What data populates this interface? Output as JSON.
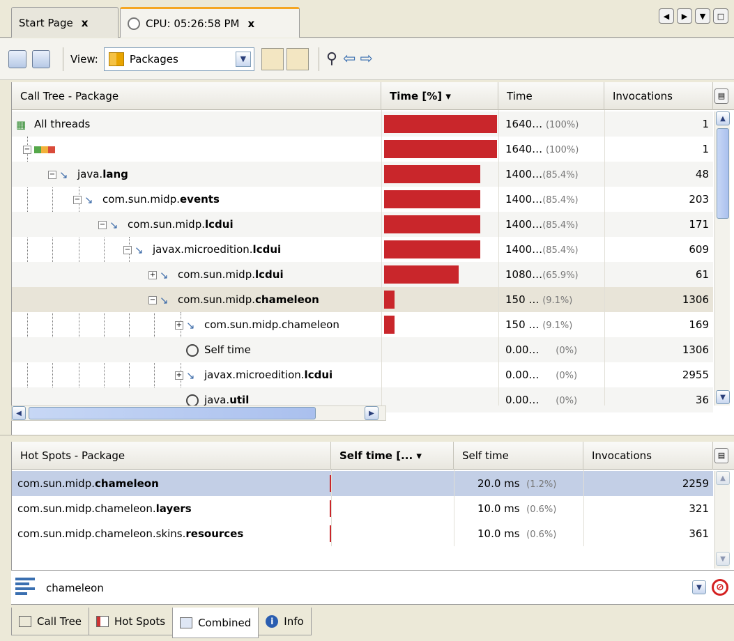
{
  "tabs": [
    {
      "label": "Start Page",
      "close": "x"
    },
    {
      "label": "CPU: 05:26:58 PM",
      "close": "x"
    }
  ],
  "toolbar": {
    "view_label": "View:",
    "view_value": "Packages"
  },
  "call_tree": {
    "headers": {
      "name": "Call Tree - Package",
      "time_pct": "Time [%] ▾",
      "time": "Time",
      "invocations": "Invocations"
    },
    "rows": [
      {
        "prefix": "",
        "bold": "All threads",
        "time": "1640…",
        "pct": "(100%)",
        "bar": 1.0,
        "inv": "1"
      },
      {
        "prefix": "",
        "bold": "",
        "time": "1640…",
        "pct": "(100%)",
        "bar": 1.0,
        "inv": "1"
      },
      {
        "prefix": "java.",
        "bold": "lang",
        "time": "1400…",
        "pct": "(85.4%)",
        "bar": 0.854,
        "inv": "48"
      },
      {
        "prefix": "com.sun.midp.",
        "bold": "events",
        "time": "1400…",
        "pct": "(85.4%)",
        "bar": 0.854,
        "inv": "203"
      },
      {
        "prefix": "com.sun.midp.",
        "bold": "lcdui",
        "time": "1400…",
        "pct": "(85.4%)",
        "bar": 0.854,
        "inv": "171"
      },
      {
        "prefix": "javax.microedition.",
        "bold": "lcdui",
        "time": "1400…",
        "pct": "(85.4%)",
        "bar": 0.854,
        "inv": "609"
      },
      {
        "prefix": "com.sun.midp.",
        "bold": "lcdui",
        "time": "1080…",
        "pct": "(65.9%)",
        "bar": 0.659,
        "inv": "61"
      },
      {
        "prefix": "com.sun.midp.",
        "bold": "chameleon",
        "time": "150 …",
        "pct": "(9.1%)",
        "bar": 0.091,
        "inv": "1306"
      },
      {
        "prefix": "com.sun.midp.chameleon",
        "bold": "",
        "time": "150 …",
        "pct": "(9.1%)",
        "bar": 0.091,
        "inv": "169"
      },
      {
        "prefix": "Self time",
        "bold": "",
        "time": "0.00…",
        "pct": "(0%)",
        "bar": 0,
        "inv": "1306"
      },
      {
        "prefix": "javax.microedition.",
        "bold": "lcdui",
        "time": "0.00…",
        "pct": "(0%)",
        "bar": 0,
        "inv": "2955"
      },
      {
        "prefix": "java.",
        "bold": "util",
        "time": "0.00…",
        "pct": "(0%)",
        "bar": 0,
        "inv": "36"
      }
    ]
  },
  "hot_spots": {
    "headers": {
      "name": "Hot Spots - Package",
      "self_pct": "Self time [... ▾",
      "self_time": "Self time",
      "invocations": "Invocations"
    },
    "rows": [
      {
        "prefix": "com.sun.midp.",
        "bold": "chameleon",
        "time": "20.0 ms",
        "pct": "(1.2%)",
        "inv": "2259"
      },
      {
        "prefix": "com.sun.midp.chameleon.",
        "bold": "layers",
        "time": "10.0 ms",
        "pct": "(0.6%)",
        "inv": "321"
      },
      {
        "prefix": "com.sun.midp.chameleon.skins.",
        "bold": "resources",
        "time": "10.0 ms",
        "pct": "(0.6%)",
        "inv": "361"
      }
    ]
  },
  "filter": {
    "value": "chameleon"
  },
  "bottom_tabs": [
    "Call Tree",
    "Hot Spots",
    "Combined",
    "Info"
  ],
  "colors": {
    "bar": "#c9262b",
    "selection": "#c3cfe6",
    "tab_accent": "#f5a623"
  }
}
